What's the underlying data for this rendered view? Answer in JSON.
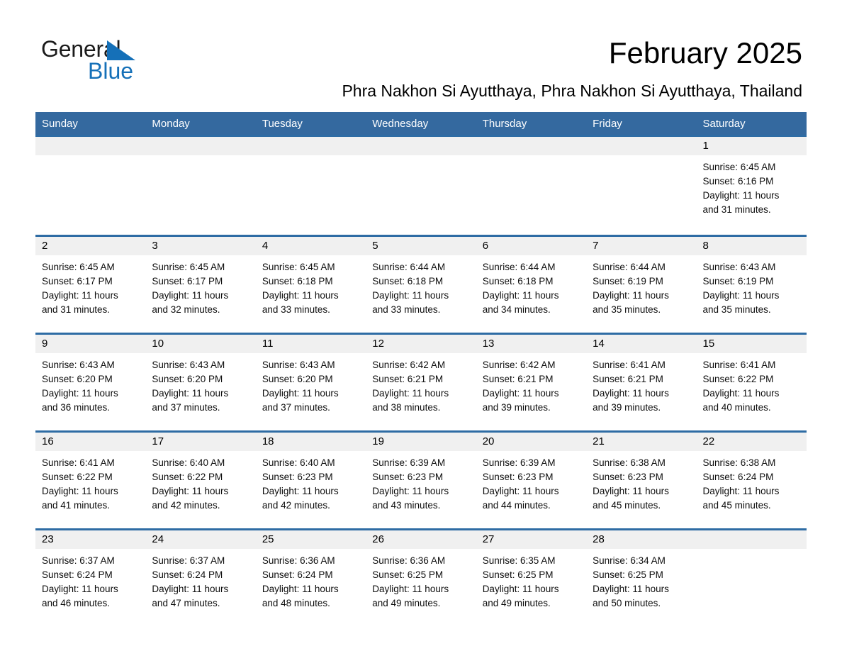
{
  "brand": {
    "logo_text_1": "General",
    "logo_text_2": "Blue",
    "logo_triangle": "triangle-icon",
    "accent_color": "#1570b8"
  },
  "header": {
    "title": "February 2025",
    "subtitle": "Phra Nakhon Si Ayutthaya, Phra Nakhon Si Ayutthaya, Thailand"
  },
  "colors": {
    "header_blue": "#34699f",
    "row_rule_blue": "#2e6ca4",
    "daynum_band": "#f0f0f0",
    "text": "#000000"
  },
  "weekday_headers": [
    "Sunday",
    "Monday",
    "Tuesday",
    "Wednesday",
    "Thursday",
    "Friday",
    "Saturday"
  ],
  "labels": {
    "sunrise_prefix": "Sunrise:",
    "sunset_prefix": "Sunset:",
    "daylight_prefix": "Daylight:"
  },
  "weeks": [
    [
      {
        "day": "",
        "empty": true
      },
      {
        "day": "",
        "empty": true
      },
      {
        "day": "",
        "empty": true
      },
      {
        "day": "",
        "empty": true
      },
      {
        "day": "",
        "empty": true
      },
      {
        "day": "",
        "empty": true
      },
      {
        "day": "1",
        "sunrise": "Sunrise: 6:45 AM",
        "sunset": "Sunset: 6:16 PM",
        "daylight_line1": "Daylight: 11 hours",
        "daylight_line2": "and 31 minutes."
      }
    ],
    [
      {
        "day": "2",
        "sunrise": "Sunrise: 6:45 AM",
        "sunset": "Sunset: 6:17 PM",
        "daylight_line1": "Daylight: 11 hours",
        "daylight_line2": "and 31 minutes."
      },
      {
        "day": "3",
        "sunrise": "Sunrise: 6:45 AM",
        "sunset": "Sunset: 6:17 PM",
        "daylight_line1": "Daylight: 11 hours",
        "daylight_line2": "and 32 minutes."
      },
      {
        "day": "4",
        "sunrise": "Sunrise: 6:45 AM",
        "sunset": "Sunset: 6:18 PM",
        "daylight_line1": "Daylight: 11 hours",
        "daylight_line2": "and 33 minutes."
      },
      {
        "day": "5",
        "sunrise": "Sunrise: 6:44 AM",
        "sunset": "Sunset: 6:18 PM",
        "daylight_line1": "Daylight: 11 hours",
        "daylight_line2": "and 33 minutes."
      },
      {
        "day": "6",
        "sunrise": "Sunrise: 6:44 AM",
        "sunset": "Sunset: 6:18 PM",
        "daylight_line1": "Daylight: 11 hours",
        "daylight_line2": "and 34 minutes."
      },
      {
        "day": "7",
        "sunrise": "Sunrise: 6:44 AM",
        "sunset": "Sunset: 6:19 PM",
        "daylight_line1": "Daylight: 11 hours",
        "daylight_line2": "and 35 minutes."
      },
      {
        "day": "8",
        "sunrise": "Sunrise: 6:43 AM",
        "sunset": "Sunset: 6:19 PM",
        "daylight_line1": "Daylight: 11 hours",
        "daylight_line2": "and 35 minutes."
      }
    ],
    [
      {
        "day": "9",
        "sunrise": "Sunrise: 6:43 AM",
        "sunset": "Sunset: 6:20 PM",
        "daylight_line1": "Daylight: 11 hours",
        "daylight_line2": "and 36 minutes."
      },
      {
        "day": "10",
        "sunrise": "Sunrise: 6:43 AM",
        "sunset": "Sunset: 6:20 PM",
        "daylight_line1": "Daylight: 11 hours",
        "daylight_line2": "and 37 minutes."
      },
      {
        "day": "11",
        "sunrise": "Sunrise: 6:43 AM",
        "sunset": "Sunset: 6:20 PM",
        "daylight_line1": "Daylight: 11 hours",
        "daylight_line2": "and 37 minutes."
      },
      {
        "day": "12",
        "sunrise": "Sunrise: 6:42 AM",
        "sunset": "Sunset: 6:21 PM",
        "daylight_line1": "Daylight: 11 hours",
        "daylight_line2": "and 38 minutes."
      },
      {
        "day": "13",
        "sunrise": "Sunrise: 6:42 AM",
        "sunset": "Sunset: 6:21 PM",
        "daylight_line1": "Daylight: 11 hours",
        "daylight_line2": "and 39 minutes."
      },
      {
        "day": "14",
        "sunrise": "Sunrise: 6:41 AM",
        "sunset": "Sunset: 6:21 PM",
        "daylight_line1": "Daylight: 11 hours",
        "daylight_line2": "and 39 minutes."
      },
      {
        "day": "15",
        "sunrise": "Sunrise: 6:41 AM",
        "sunset": "Sunset: 6:22 PM",
        "daylight_line1": "Daylight: 11 hours",
        "daylight_line2": "and 40 minutes."
      }
    ],
    [
      {
        "day": "16",
        "sunrise": "Sunrise: 6:41 AM",
        "sunset": "Sunset: 6:22 PM",
        "daylight_line1": "Daylight: 11 hours",
        "daylight_line2": "and 41 minutes."
      },
      {
        "day": "17",
        "sunrise": "Sunrise: 6:40 AM",
        "sunset": "Sunset: 6:22 PM",
        "daylight_line1": "Daylight: 11 hours",
        "daylight_line2": "and 42 minutes."
      },
      {
        "day": "18",
        "sunrise": "Sunrise: 6:40 AM",
        "sunset": "Sunset: 6:23 PM",
        "daylight_line1": "Daylight: 11 hours",
        "daylight_line2": "and 42 minutes."
      },
      {
        "day": "19",
        "sunrise": "Sunrise: 6:39 AM",
        "sunset": "Sunset: 6:23 PM",
        "daylight_line1": "Daylight: 11 hours",
        "daylight_line2": "and 43 minutes."
      },
      {
        "day": "20",
        "sunrise": "Sunrise: 6:39 AM",
        "sunset": "Sunset: 6:23 PM",
        "daylight_line1": "Daylight: 11 hours",
        "daylight_line2": "and 44 minutes."
      },
      {
        "day": "21",
        "sunrise": "Sunrise: 6:38 AM",
        "sunset": "Sunset: 6:23 PM",
        "daylight_line1": "Daylight: 11 hours",
        "daylight_line2": "and 45 minutes."
      },
      {
        "day": "22",
        "sunrise": "Sunrise: 6:38 AM",
        "sunset": "Sunset: 6:24 PM",
        "daylight_line1": "Daylight: 11 hours",
        "daylight_line2": "and 45 minutes."
      }
    ],
    [
      {
        "day": "23",
        "sunrise": "Sunrise: 6:37 AM",
        "sunset": "Sunset: 6:24 PM",
        "daylight_line1": "Daylight: 11 hours",
        "daylight_line2": "and 46 minutes."
      },
      {
        "day": "24",
        "sunrise": "Sunrise: 6:37 AM",
        "sunset": "Sunset: 6:24 PM",
        "daylight_line1": "Daylight: 11 hours",
        "daylight_line2": "and 47 minutes."
      },
      {
        "day": "25",
        "sunrise": "Sunrise: 6:36 AM",
        "sunset": "Sunset: 6:24 PM",
        "daylight_line1": "Daylight: 11 hours",
        "daylight_line2": "and 48 minutes."
      },
      {
        "day": "26",
        "sunrise": "Sunrise: 6:36 AM",
        "sunset": "Sunset: 6:25 PM",
        "daylight_line1": "Daylight: 11 hours",
        "daylight_line2": "and 49 minutes."
      },
      {
        "day": "27",
        "sunrise": "Sunrise: 6:35 AM",
        "sunset": "Sunset: 6:25 PM",
        "daylight_line1": "Daylight: 11 hours",
        "daylight_line2": "and 49 minutes."
      },
      {
        "day": "28",
        "sunrise": "Sunrise: 6:34 AM",
        "sunset": "Sunset: 6:25 PM",
        "daylight_line1": "Daylight: 11 hours",
        "daylight_line2": "and 50 minutes."
      },
      {
        "day": "",
        "empty": true
      }
    ]
  ]
}
